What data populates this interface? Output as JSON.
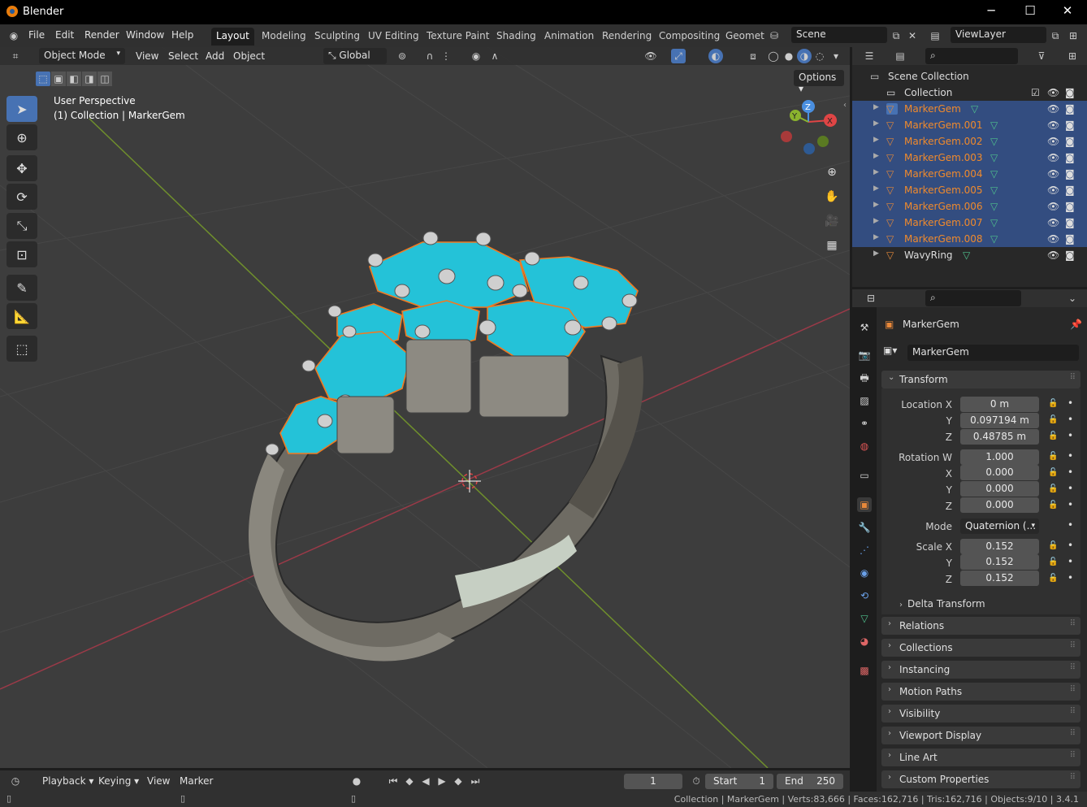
{
  "window": {
    "title": "Blender",
    "minimize": "─",
    "maximize": "☐",
    "close": "✕"
  },
  "menubar": {
    "menus": [
      "File",
      "Edit",
      "Render",
      "Window",
      "Help"
    ],
    "workspaces": [
      "Layout",
      "Modeling",
      "Sculpting",
      "UV Editing",
      "Texture Paint",
      "Shading",
      "Animation",
      "Rendering",
      "Compositing",
      "Geomet"
    ],
    "active_workspace": "Layout",
    "scene": "Scene",
    "view_layer": "ViewLayer"
  },
  "viewport": {
    "mode": "Object Mode",
    "menus": [
      "View",
      "Select",
      "Add",
      "Object"
    ],
    "transform_orientation": "Global",
    "options_label": "Options",
    "overlay_title": "User Perspective",
    "overlay_subtitle": "(1) Collection | MarkerGem",
    "gizmo": {
      "x": "X",
      "y": "Y",
      "z": "Z"
    }
  },
  "outliner": {
    "scene_collection": "Scene Collection",
    "collection": "Collection",
    "items": [
      {
        "name": "MarkerGem",
        "selected": true,
        "active": true
      },
      {
        "name": "MarkerGem.001",
        "selected": true
      },
      {
        "name": "MarkerGem.002",
        "selected": true
      },
      {
        "name": "MarkerGem.003",
        "selected": true
      },
      {
        "name": "MarkerGem.004",
        "selected": true
      },
      {
        "name": "MarkerGem.005",
        "selected": true
      },
      {
        "name": "MarkerGem.006",
        "selected": true
      },
      {
        "name": "MarkerGem.007",
        "selected": true
      },
      {
        "name": "MarkerGem.008",
        "selected": true
      },
      {
        "name": "WavyRing",
        "selected": false
      }
    ]
  },
  "properties": {
    "object_name": "MarkerGem",
    "object_field": "MarkerGem",
    "transform_label": "Transform",
    "location": {
      "label_x": "Location X",
      "label_y": "Y",
      "label_z": "Z",
      "x": "0 m",
      "y": "0.097194 m",
      "z": "0.48785 m"
    },
    "rotation": {
      "label_w": "Rotation W",
      "label_x": "X",
      "label_y": "Y",
      "label_z": "Z",
      "w": "1.000",
      "x": "0.000",
      "y": "0.000",
      "z": "0.000"
    },
    "mode": {
      "label": "Mode",
      "value": "Quaternion (..."
    },
    "scale": {
      "label_x": "Scale X",
      "label_y": "Y",
      "label_z": "Z",
      "x": "0.152",
      "y": "0.152",
      "z": "0.152"
    },
    "delta_transform": "Delta Transform",
    "panels": [
      "Relations",
      "Collections",
      "Instancing",
      "Motion Paths",
      "Visibility",
      "Viewport Display",
      "Line Art",
      "Custom Properties"
    ]
  },
  "timeline": {
    "menus": [
      "Playback",
      "Keying",
      "View",
      "Marker"
    ],
    "current_frame": "1",
    "start_label": "Start",
    "start": "1",
    "end_label": "End",
    "end": "250"
  },
  "statusbar": {
    "text": "Collection | MarkerGem | Verts:83,666 | Faces:162,716 | Tris:162,716 | Objects:9/10 | 3.4.1"
  },
  "colors": {
    "selected_text": "#f08a2c",
    "selection_bg": "#334d80",
    "active_blue": "#4772b3",
    "gem": "#24c2d8",
    "mesh_icon": "#4fc08d"
  }
}
